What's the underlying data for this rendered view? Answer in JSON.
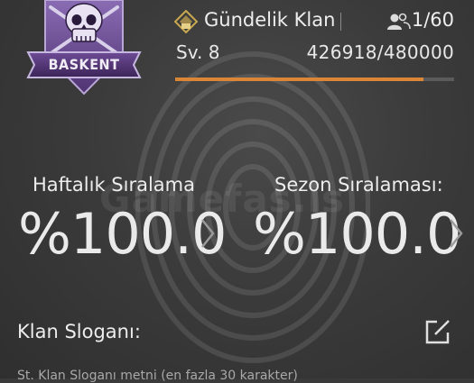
{
  "clan": {
    "badge_name": "BASKENT",
    "name": "Gündelik Klan",
    "members": "1/60",
    "level": "Sv. 8",
    "xp": "426918/480000",
    "xp_progress": 0.889
  },
  "rankings": {
    "weekly_label": "Haftalık Sıralama",
    "weekly_value": "%100.0",
    "season_label": "Sezon Sıralaması:",
    "season_value": "%100.0"
  },
  "slogan": {
    "label": "Klan Sloganı:",
    "text": "St. Klan Sloganı metni (en fazla 30 karakter)"
  },
  "watermark": "Gamefas.is",
  "icons": {
    "badge": "skull-crossed-swords-badge-icon",
    "clan": "clan-emblem-icon",
    "members": "members-icon",
    "chevron": "chevron-right-icon",
    "edit": "edit-icon"
  },
  "colors": {
    "background": "#3a3a3a",
    "accent_progress": "#d98736",
    "badge_purple": "#6a4a94",
    "clan_icon_gold": "#c9a84e"
  }
}
